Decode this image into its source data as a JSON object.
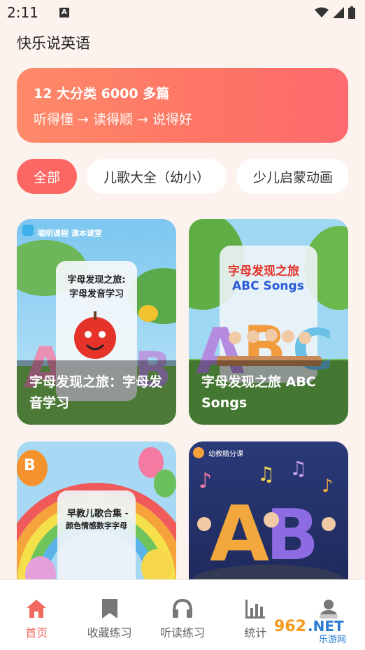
{
  "status": {
    "time": "2:11"
  },
  "app": {
    "title": "快乐说英语"
  },
  "banner": {
    "title": "12 大分类 6000 多篇",
    "subtitle": "听得懂 → 读得顺 → 说得好"
  },
  "tabs": [
    {
      "label": "全部",
      "active": true
    },
    {
      "label": "儿歌大全（幼小）",
      "active": false
    },
    {
      "label": "少儿启蒙动画",
      "active": false
    }
  ],
  "cards": [
    {
      "caption": "字母发现之旅：字母发音学习",
      "art_title": "字母发现之旅:\n字母发音学习",
      "brand": "聪明课程 课本课堂"
    },
    {
      "caption": "字母发现之旅 ABC Songs",
      "art_title": "字母发现之旅",
      "art_subtitle": "ABC Songs"
    },
    {
      "caption": "",
      "art_title": "早教儿歌合集 -",
      "art_subtitle": "颜色情感数字字母"
    },
    {
      "caption": "",
      "brand": "幼教精分课"
    }
  ],
  "bottom_nav": [
    {
      "label": "首页",
      "icon": "home-icon",
      "active": true
    },
    {
      "label": "收藏练习",
      "icon": "bookmark-icon",
      "active": false
    },
    {
      "label": "听读练习",
      "icon": "headphones-icon",
      "active": false
    },
    {
      "label": "统计",
      "icon": "bar-chart-icon",
      "active": false
    },
    {
      "label": "",
      "icon": "user-icon",
      "active": false
    }
  ],
  "watermark": {
    "text": "962.NET",
    "sub": "乐游网"
  },
  "colors": {
    "accent": "#fd6763",
    "banner": "#fe7f67",
    "background": "#fdf3ee"
  }
}
